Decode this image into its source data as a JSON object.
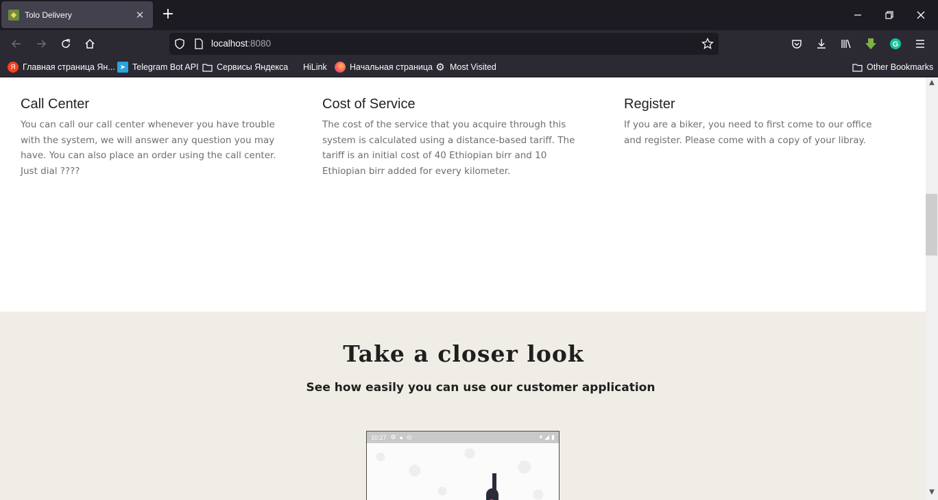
{
  "browser": {
    "tab": {
      "title": "Tolo Delivery"
    },
    "url": {
      "host": "localhost",
      "port": ":8080"
    },
    "bookmarks": [
      {
        "label": "Главная страница Ян...",
        "icon": "yandex-icon"
      },
      {
        "label": "Telegram Bot API",
        "icon": "telegram-icon"
      },
      {
        "label": "Сервисы Яндекса",
        "icon": "folder-icon"
      },
      {
        "label": "HiLink",
        "icon": "none"
      },
      {
        "label": "Начальная страница",
        "icon": "firefox-icon"
      },
      {
        "label": "Most Visited",
        "icon": "gear-icon"
      }
    ],
    "other_bookmarks": "Other Bookmarks"
  },
  "features": [
    {
      "title": "Call Center",
      "body": "You can call our call center whenever you have trouble with the system, we will answer any question you may have. You can also place an order using the call center. Just dial ????"
    },
    {
      "title": "Cost of Service",
      "body": "The cost of the service that you acquire through this system is calculated using a distance-based tariff. The tariff is an initial cost of 40 Ethiopian birr and 10 Ethiopian birr added for every kilometer."
    },
    {
      "title": "Register",
      "body": "If you are a biker, you need to first come to our office and register. Please come with a copy of your libray."
    }
  ],
  "closer_look": {
    "title": "Take a closer look",
    "subtitle": "See how easily you can use our customer application"
  },
  "phone": {
    "status_time": "10:27"
  },
  "colors": {
    "section_bg": "#f0ede6",
    "chrome_bg": "#1c1b22",
    "toolbar_bg": "#2b2a33"
  }
}
